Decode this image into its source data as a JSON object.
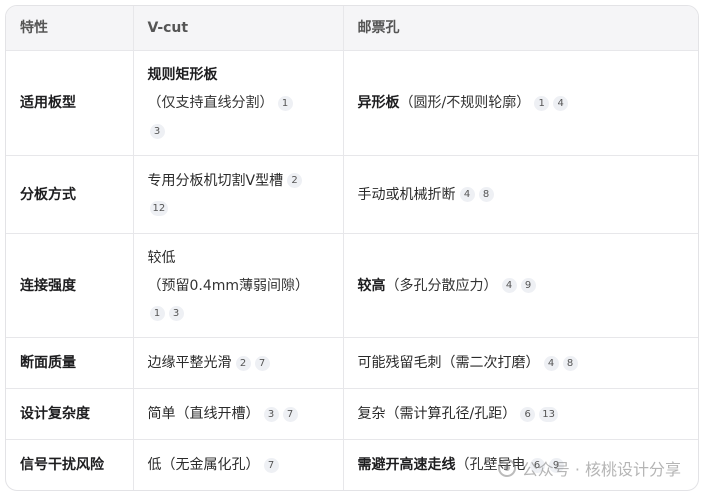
{
  "header": {
    "col1": "特性",
    "col2": "V-cut",
    "col3": "邮票孔"
  },
  "rows": [
    {
      "feature": "适用板型",
      "vcut": {
        "main": "规则矩形板",
        "note": "（仅支持直线分割）",
        "cites": [
          "1",
          "3"
        ]
      },
      "stamp": {
        "main": "异形板",
        "note": "（圆形/不规则轮廓）",
        "cites": [
          "1",
          "4"
        ]
      }
    },
    {
      "feature": "分板方式",
      "vcut": {
        "text": "专用分板机切割V型槽",
        "cites": [
          "2",
          "12"
        ]
      },
      "stamp": {
        "text": "手动或机械折断",
        "cites": [
          "4",
          "8"
        ]
      }
    },
    {
      "feature": "连接强度",
      "vcut": {
        "main": "较低",
        "note": "（预留0.4mm薄弱间隙）",
        "cites": [
          "1",
          "3"
        ]
      },
      "stamp": {
        "main": "较高",
        "note": "（多孔分散应力）",
        "cites": [
          "4",
          "9"
        ]
      }
    },
    {
      "feature": "断面质量",
      "vcut": {
        "text": "边缘平整光滑",
        "cites": [
          "2",
          "7"
        ]
      },
      "stamp": {
        "text": "可能残留毛刺（需二次打磨）",
        "cites": [
          "4",
          "8"
        ]
      }
    },
    {
      "feature": "设计复杂度",
      "vcut": {
        "text": "简单（直线开槽）",
        "cites": [
          "3",
          "7"
        ]
      },
      "stamp": {
        "text": "复杂（需计算孔径/孔距）",
        "cites": [
          "6",
          "13"
        ]
      }
    },
    {
      "feature": "信号干扰风险",
      "vcut": {
        "text": "低（无金属化孔）",
        "cites": [
          "7"
        ]
      },
      "stamp": {
        "main": "需避开高速走线",
        "note": "（孔壁导电",
        "cites": [
          "6",
          "9"
        ]
      }
    }
  ],
  "watermark": {
    "text": "公众号 · 核桃设计分享",
    "icon": "wechat-logo-icon"
  }
}
